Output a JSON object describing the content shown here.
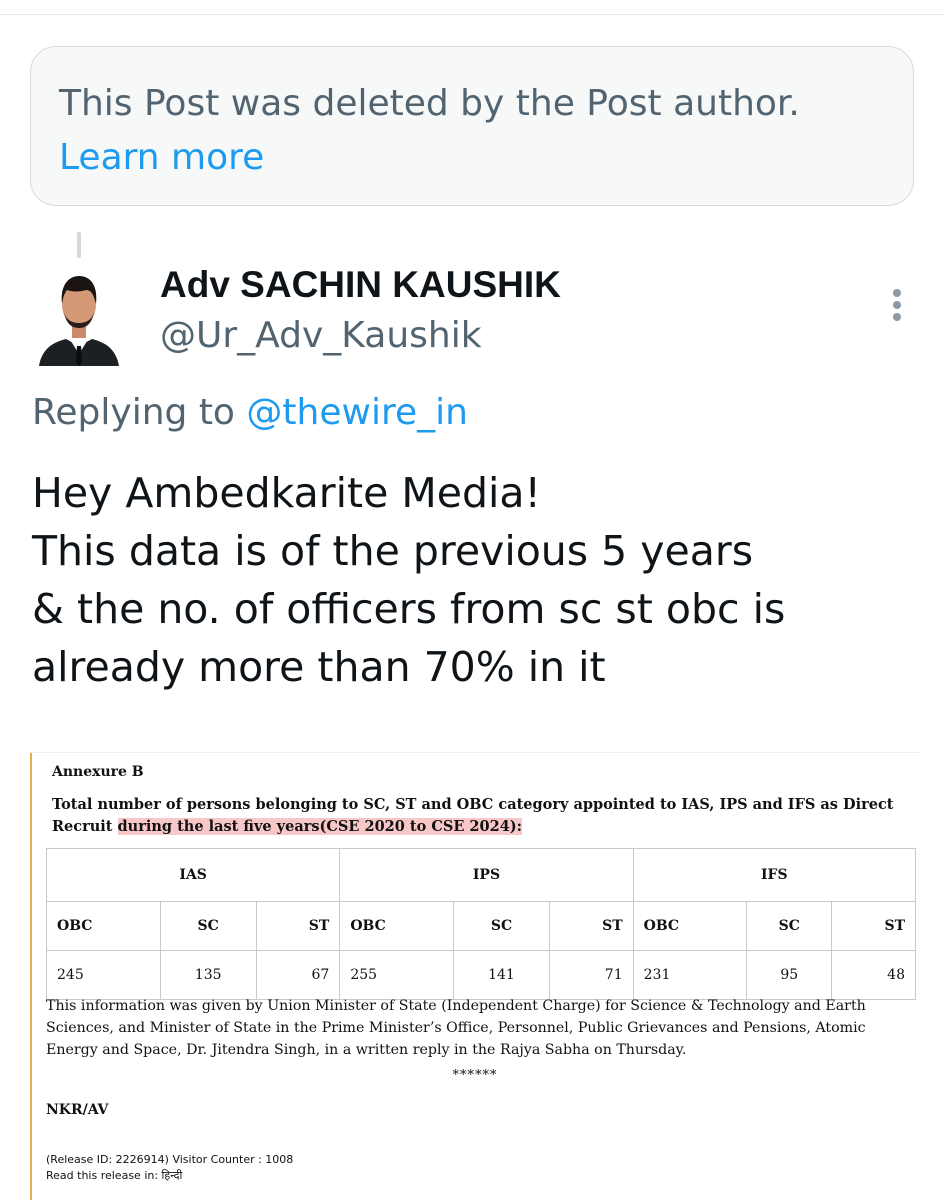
{
  "deleted_notice": {
    "text": "This Post was deleted by the Post author.",
    "link": "Learn more"
  },
  "post": {
    "author_name": "Adv SACHIN KAUSHIK",
    "author_handle": "@Ur_Adv_Kaushik",
    "replying_prefix": "Replying to",
    "replying_handle": "@thewire_in",
    "text_lines": [
      "Hey Ambedkarite Media!",
      "This data is of the previous 5 years",
      "& the no. of officers from sc st obc is",
      "already more than 70% in it"
    ]
  },
  "document": {
    "annexure": "Annexure B",
    "description_plain": "Total number of persons belonging to SC, ST and OBC category appointed to IAS, IPS and IFS as Direct Recruit ",
    "description_highlight": "during the last five years(CSE 2020 to CSE 2024):",
    "groups": [
      "IAS",
      "IPS",
      "IFS"
    ],
    "subheaders": [
      "OBC",
      "SC",
      "ST",
      "OBC",
      "SC",
      "ST",
      "OBC",
      "SC",
      "ST"
    ],
    "values": [
      "245",
      "135",
      "67",
      "255",
      "141",
      "71",
      "231",
      "95",
      "48"
    ],
    "info": "This information was given by Union Minister of State (Independent Charge) for Science & Technology and Earth Sciences, and Minister of State in the Prime Minister’s Office, Personnel, Public Grievances and Pensions, Atomic Energy and Space, Dr. Jitendra Singh, in a written reply in the Rajya Sabha on Thursday.",
    "stars": "******",
    "footer_code": "NKR/AV",
    "release_line": "(Release ID: 2226914) Visitor Counter : 1008",
    "read_line": "Read this release in: हिन्दी"
  },
  "colors": {
    "link": "#1d9bf0",
    "secondary_text": "#536471",
    "highlight": "#f8c8c8"
  }
}
